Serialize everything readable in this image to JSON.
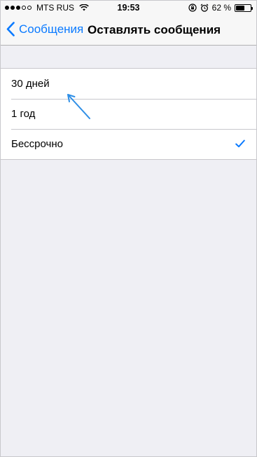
{
  "status_bar": {
    "carrier": "MTS RUS",
    "time": "19:53",
    "battery_percent_label": "62 %",
    "battery_level": 0.62,
    "icons": [
      "signal-dots-icon",
      "wifi-icon",
      "lock-rotation-icon",
      "alarm-icon",
      "battery-icon"
    ]
  },
  "nav": {
    "back_label": "Сообщения",
    "title": "Оставлять сообщения"
  },
  "options": [
    {
      "label": "30 дней",
      "selected": false
    },
    {
      "label": "1 год",
      "selected": false
    },
    {
      "label": "Бессрочно",
      "selected": true
    }
  ],
  "colors": {
    "accent": "#0a7aff",
    "background": "#efeff4",
    "annotation_arrow": "#2f8fe6"
  }
}
